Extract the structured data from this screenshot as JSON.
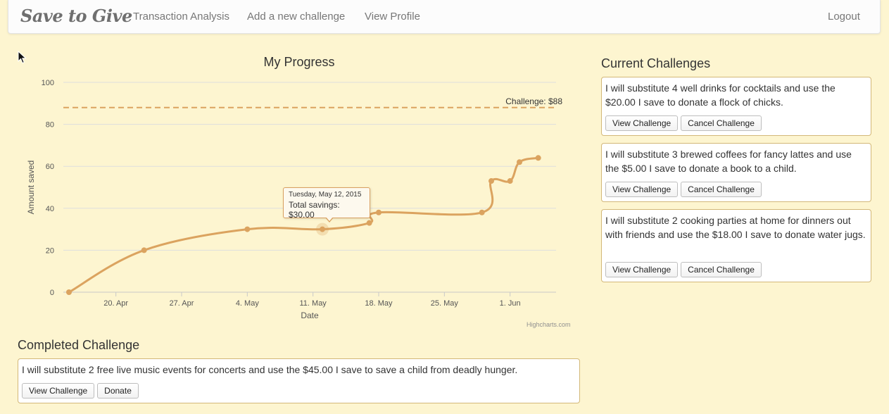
{
  "navbar": {
    "brand": "Save to Give",
    "links": [
      "Transaction Analysis",
      "Add a new challenge",
      "View Profile"
    ],
    "logout": "Logout"
  },
  "progress": {
    "title": "My Progress",
    "tooltip": {
      "date": "Tuesday, May 12, 2015",
      "value": "Total savings: $30.00"
    },
    "credits": "Highcharts.com",
    "challenge_label": "Challenge: $88"
  },
  "chart_data": {
    "type": "line",
    "title": "My Progress",
    "xlabel": "Date",
    "ylabel": "Amount saved",
    "ylim": [
      0,
      100
    ],
    "yticks": [
      0,
      20,
      40,
      60,
      80,
      100
    ],
    "xticks": [
      "20. Apr",
      "27. Apr",
      "4. May",
      "11. May",
      "18. May",
      "25. May",
      "1. Jun"
    ],
    "x_dates": [
      "2015-04-15",
      "2015-04-23",
      "2015-05-04",
      "2015-05-12",
      "2015-05-17",
      "2015-05-18",
      "2015-05-29",
      "2015-05-30",
      "2015-06-01",
      "2015-06-02",
      "2015-06-04"
    ],
    "series": [
      {
        "values": [
          0,
          20,
          30,
          30,
          33,
          38,
          38,
          53,
          53,
          62,
          64
        ]
      }
    ],
    "plotlines": [
      {
        "label": "Challenge: $88",
        "value": 88
      }
    ],
    "grid": true,
    "color": "#dba35f"
  },
  "current": {
    "title": "Current Challenges",
    "items": [
      {
        "text": "I will substitute 4 well drinks for cocktails and use the $20.00 I save to donate a flock of chicks.",
        "view": "View Challenge",
        "cancel": "Cancel Challenge"
      },
      {
        "text": "I will substitute 3 brewed coffees for fancy lattes and use the $5.00 I save to donate a book to a child.",
        "view": "View Challenge",
        "cancel": "Cancel Challenge"
      },
      {
        "text": "I will substitute 2 cooking parties at home for dinners out with friends and use the $18.00 I save to donate water jugs.",
        "view": "View Challenge",
        "cancel": "Cancel Challenge"
      }
    ]
  },
  "completed": {
    "title": "Completed Challenge",
    "text": "I will substitute 2 free live music events for concerts and use the $45.00 I save to save a child from deadly hunger.",
    "view": "View Challenge",
    "donate": "Donate"
  }
}
